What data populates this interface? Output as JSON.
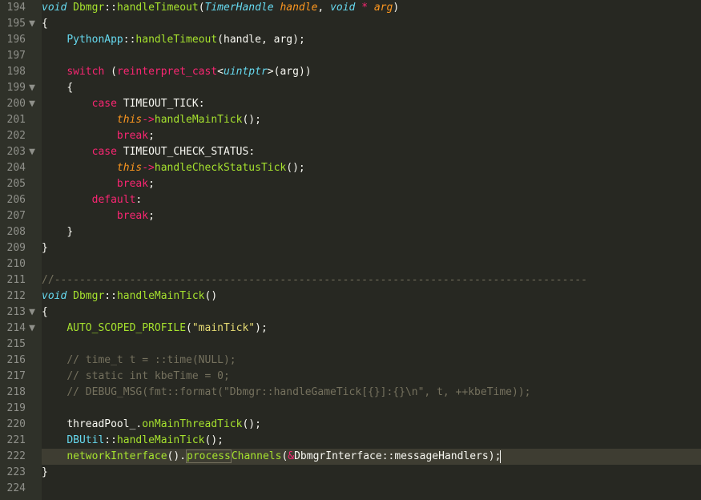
{
  "gutter": [
    {
      "n": "194",
      "fold": ""
    },
    {
      "n": "195",
      "fold": "▼"
    },
    {
      "n": "196",
      "fold": ""
    },
    {
      "n": "197",
      "fold": ""
    },
    {
      "n": "198",
      "fold": ""
    },
    {
      "n": "199",
      "fold": "▼"
    },
    {
      "n": "200",
      "fold": "▼"
    },
    {
      "n": "201",
      "fold": ""
    },
    {
      "n": "202",
      "fold": ""
    },
    {
      "n": "203",
      "fold": "▼"
    },
    {
      "n": "204",
      "fold": ""
    },
    {
      "n": "205",
      "fold": ""
    },
    {
      "n": "206",
      "fold": ""
    },
    {
      "n": "207",
      "fold": ""
    },
    {
      "n": "208",
      "fold": ""
    },
    {
      "n": "209",
      "fold": ""
    },
    {
      "n": "210",
      "fold": ""
    },
    {
      "n": "211",
      "fold": ""
    },
    {
      "n": "212",
      "fold": ""
    },
    {
      "n": "213",
      "fold": "▼"
    },
    {
      "n": "214",
      "fold": "▼"
    },
    {
      "n": "215",
      "fold": ""
    },
    {
      "n": "216",
      "fold": ""
    },
    {
      "n": "217",
      "fold": ""
    },
    {
      "n": "218",
      "fold": ""
    },
    {
      "n": "219",
      "fold": ""
    },
    {
      "n": "220",
      "fold": ""
    },
    {
      "n": "221",
      "fold": ""
    },
    {
      "n": "222",
      "fold": ""
    },
    {
      "n": "223",
      "fold": ""
    },
    {
      "n": "224",
      "fold": ""
    }
  ],
  "t": {
    "void1": "void",
    "dbmgr": "Dbmgr",
    "dcolon": "::",
    "handleTimeout": "handleTimeout",
    "lparen": "(",
    "TimerHandle": "TimerHandle",
    "sp": " ",
    "handle": "handle",
    "comma": ", ",
    "void2": "void",
    "star": " * ",
    "arg": "arg",
    "rparen": ")",
    "lbrace": "{",
    "rbrace": "}",
    "PythonApp": "PythonApp",
    "handleTimeoutCall": "handleTimeout",
    "handle2": "handle",
    "arg2": "arg",
    "semi": ";",
    "switch": "switch",
    "reinterpret_cast": "reinterpret_cast",
    "lt": "<",
    "uintptr": "uintptr",
    "gt": ">",
    "case": "case",
    "TIMEOUT_TICK": " TIMEOUT_TICK",
    "colon": ":",
    "this": "this",
    "arrow": "->",
    "handleMainTick": "handleMainTick",
    "emptyparen": "()",
    "break": "break",
    "TIMEOUT_CHECK_STATUS": " TIMEOUT_CHECK_STATUS",
    "handleCheckStatusTick": "handleCheckStatusTick",
    "default": "default",
    "divline": "//-------------------------------------------------------------------------------------",
    "handleMainTickDecl": "handleMainTick",
    "AUTO_SCOPED_PROFILE": "AUTO_SCOPED_PROFILE",
    "mainTick": "\"mainTick\"",
    "cm1": "// time_t t = ::time(NULL);",
    "cm2": "// static int kbeTime = 0;",
    "cm3": "// DEBUG_MSG(fmt::format(\"Dbmgr::handleGameTick[{}]:{}\\n\", t, ++kbeTime));",
    "threadPool_": "threadPool_",
    "dot": ".",
    "onMainThreadTick": "onMainThreadTick",
    "DBUtil": "DBUtil",
    "handleMainTick2": "handleMainTick",
    "networkInterface": "networkInterface",
    "process": "process",
    "Channels": "Channels",
    "amp": "&",
    "DbmgrInterface": "DbmgrInterface",
    "messageHandlers": "messageHandlers",
    "pad4": "    ",
    "pad8": "        ",
    "pad12": "            ",
    "pad16": "                "
  }
}
